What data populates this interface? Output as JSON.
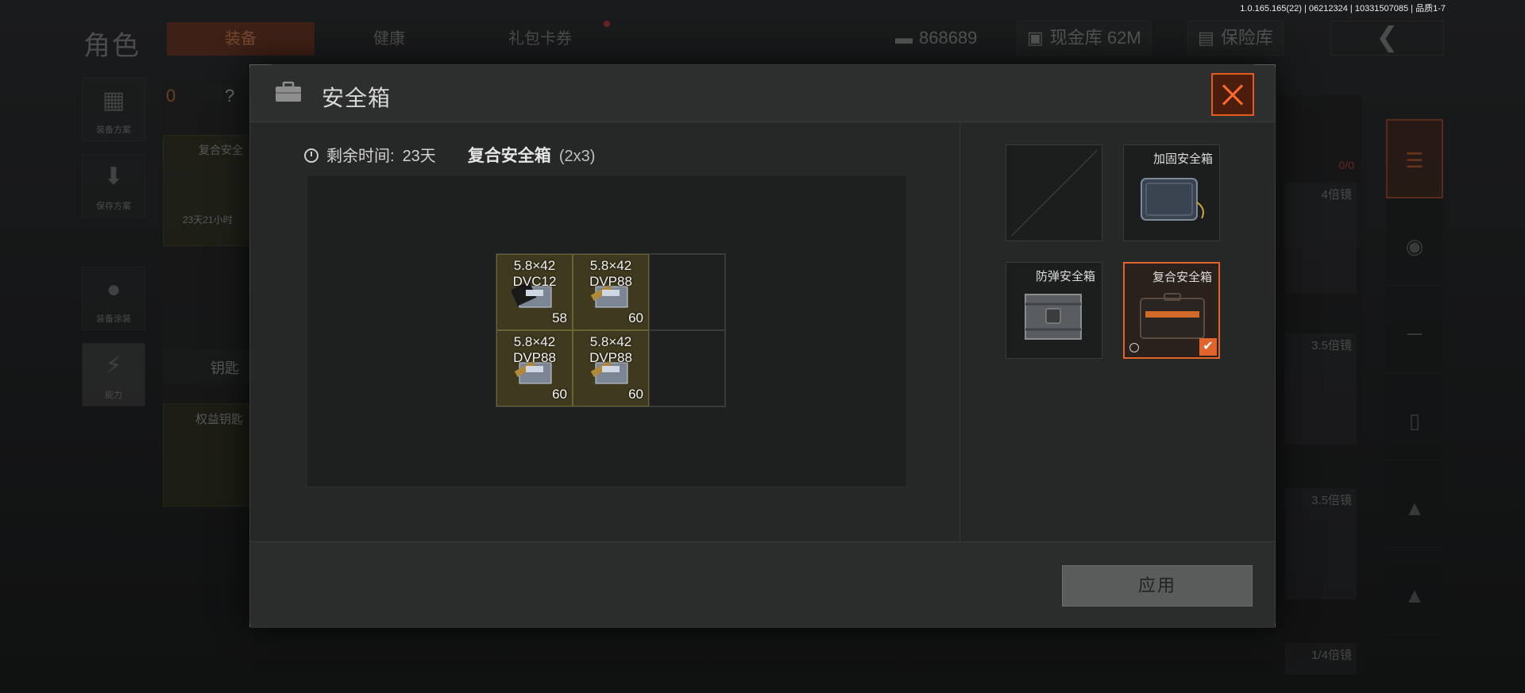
{
  "version": "1.0.165.165(22) | 06212324 | 10331507085 | 品质1-7",
  "background": {
    "page_title": "角色",
    "tabs": [
      {
        "label": "装备"
      },
      {
        "label": "健康"
      },
      {
        "label": "礼包卡券"
      }
    ],
    "currency": {
      "coins": "868689",
      "vault": "现金库 62M",
      "insurance": "保险库"
    },
    "side_buttons": [
      {
        "label": "装备方案"
      },
      {
        "label": "保存方案"
      },
      {
        "label": "装备涂装"
      },
      {
        "label": "能力"
      }
    ],
    "left_slot_labels": {
      "slot1": "复合安全",
      "slot1_time": "23天21小时",
      "key": "钥匙",
      "key_slot": "权益钥匙"
    },
    "counts": {
      "backpack": "0",
      "help": "?",
      "ammo_ratio": "0/0"
    },
    "scopes": [
      {
        "label": "4倍镜"
      },
      {
        "label": "3.5倍镜"
      },
      {
        "label": "3.5倍镜"
      },
      {
        "label": "1/4倍镜"
      }
    ]
  },
  "modal": {
    "title": "安全箱",
    "remaining_label": "剩余时间:",
    "remaining_value": "23天",
    "case_name": "复合安全箱",
    "case_dims": "(2x3)",
    "grid_items": [
      {
        "caliber": "5.8×42",
        "type": "DVC12",
        "count": "58"
      },
      {
        "caliber": "5.8×42",
        "type": "DVP88",
        "count": "60"
      },
      {
        "caliber": "5.8×42",
        "type": "DVP88",
        "count": "60"
      },
      {
        "caliber": "5.8×42",
        "type": "DVP88",
        "count": "60"
      }
    ],
    "case_options": [
      {
        "name": ""
      },
      {
        "name": "加固安全箱"
      },
      {
        "name": "防弹安全箱"
      },
      {
        "name": "复合安全箱",
        "selected": true
      }
    ],
    "apply_label": "应用"
  },
  "colors": {
    "accent": "#e0642b",
    "ammo_cell": "#3f3a1f",
    "modal_bg": "#262727"
  }
}
